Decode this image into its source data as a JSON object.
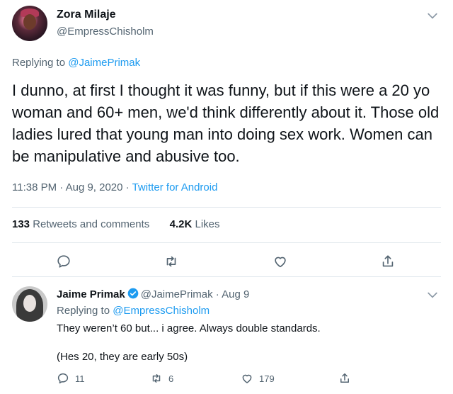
{
  "main_tweet": {
    "author_name": "Zora Milaje",
    "author_handle": "@EmpressChisholm",
    "replying_prefix": "Replying to ",
    "replying_to": "@JaimePrimak",
    "text": "I dunno, at first I thought it was funny, but if this were a 20 yo woman and 60+ men, we'd think differently about it. Those old ladies lured that young man into doing sex work. Women can be manipulative and abusive too.",
    "time": "11:38 PM · Aug 9, 2020 · ",
    "source": "Twitter for Android",
    "retweets_count": "133",
    "retweets_label": "Retweets and comments",
    "likes_count": "4.2K",
    "likes_label": "Likes"
  },
  "reply_tweet": {
    "author_name": "Jaime Primak",
    "author_handle": "@JaimePrimak · Aug 9",
    "replying_prefix": "Replying to ",
    "replying_to": "@EmpressChisholm",
    "line1": "They weren’t 60 but... i agree. Always double standards.",
    "line2": "(Hes 20, they are early 50s)",
    "reply_count": "11",
    "retweet_count": "6",
    "like_count": "179"
  },
  "icons": {
    "reply": "reply-icon",
    "retweet": "retweet-icon",
    "like": "heart-icon",
    "share": "share-icon",
    "more": "chevron-down-icon",
    "verified": "verified-badge-icon"
  },
  "colors": {
    "link": "#1d9bf0",
    "muted": "#536471",
    "text": "#0f1419",
    "divider": "#e1e8ed"
  }
}
